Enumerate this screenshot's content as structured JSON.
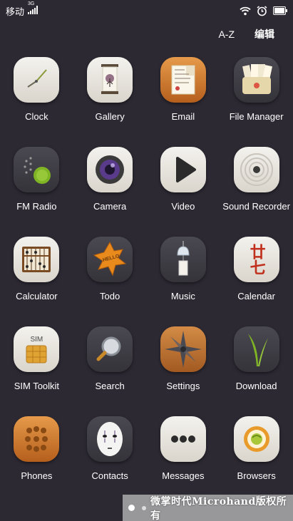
{
  "status_bar": {
    "carrier": "移动",
    "network_badge": "3G",
    "icons": [
      "signal-icon",
      "wifi-icon",
      "alarm-icon",
      "battery-icon"
    ]
  },
  "topbar": {
    "sort_label": "A-Z",
    "edit_label": "编辑"
  },
  "apps": [
    {
      "label": "Clock",
      "icon": "clock-icon"
    },
    {
      "label": "Gallery",
      "icon": "gallery-icon"
    },
    {
      "label": "Email",
      "icon": "email-icon"
    },
    {
      "label": "File Manager",
      "icon": "file-manager-icon"
    },
    {
      "label": "FM Radio",
      "icon": "fm-radio-icon"
    },
    {
      "label": "Camera",
      "icon": "camera-icon"
    },
    {
      "label": "Video",
      "icon": "video-icon"
    },
    {
      "label": "Sound Recorder",
      "icon": "sound-recorder-icon"
    },
    {
      "label": "Calculator",
      "icon": "calculator-icon"
    },
    {
      "label": "Todo",
      "icon": "todo-icon"
    },
    {
      "label": "Music",
      "icon": "music-icon"
    },
    {
      "label": "Calendar",
      "icon": "calendar-icon"
    },
    {
      "label": "SIM Toolkit",
      "icon": "sim-toolkit-icon"
    },
    {
      "label": "Search",
      "icon": "search-icon"
    },
    {
      "label": "Settings",
      "icon": "settings-icon"
    },
    {
      "label": "Download",
      "icon": "download-icon"
    },
    {
      "label": "Phones",
      "icon": "phone-icon"
    },
    {
      "label": "Contacts",
      "icon": "contacts-icon"
    },
    {
      "label": "Messages",
      "icon": "messages-icon"
    },
    {
      "label": "Browsers",
      "icon": "browser-icon"
    }
  ],
  "icon_text": {
    "sim": "SIM",
    "calendar": "廿七",
    "todo": "HELLO"
  },
  "page_indicator": {
    "pages": 2,
    "current": 1
  },
  "watermark": "微掌时代Microhand版权所有"
}
